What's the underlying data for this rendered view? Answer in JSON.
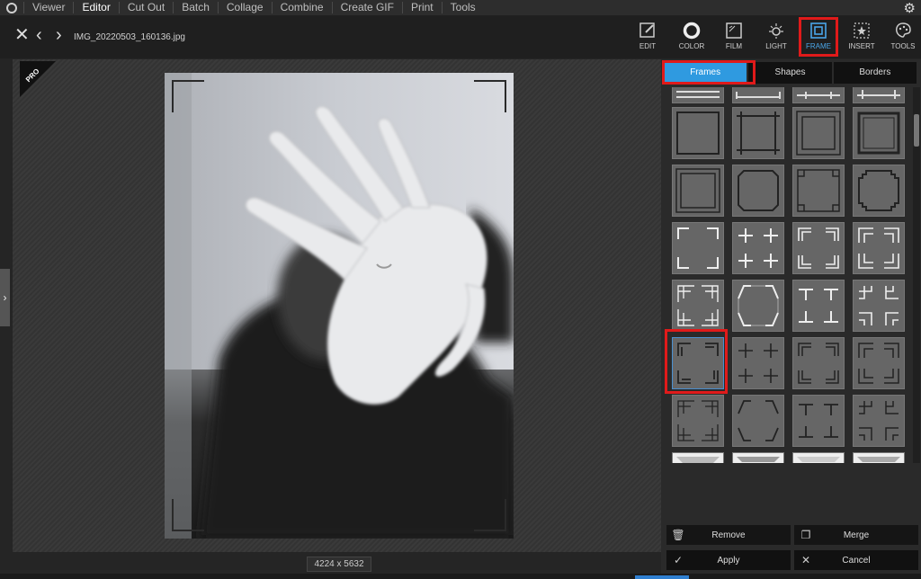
{
  "menu": {
    "items": [
      "Viewer",
      "Editor",
      "Cut Out",
      "Batch",
      "Collage",
      "Combine",
      "Create GIF",
      "Print",
      "Tools"
    ],
    "active": "Editor"
  },
  "toolbar": {
    "filename": "IMG_20220503_160136.jpg",
    "tools": [
      {
        "id": "edit",
        "label": "EDIT",
        "icon": "edit-icon"
      },
      {
        "id": "color",
        "label": "COLOR",
        "icon": "color-circle-icon"
      },
      {
        "id": "film",
        "label": "FILM",
        "icon": "film-icon"
      },
      {
        "id": "light",
        "label": "LIGHT",
        "icon": "sun-icon"
      },
      {
        "id": "frame",
        "label": "FRAME",
        "icon": "frame-icon"
      },
      {
        "id": "insert",
        "label": "INSERT",
        "icon": "insert-star-icon"
      },
      {
        "id": "tools",
        "label": "TOOLS",
        "icon": "palette-icon"
      }
    ],
    "active_tool": "frame"
  },
  "canvas": {
    "dimensions": "4224 x 5632",
    "badge": "PRO"
  },
  "panel": {
    "tabs": [
      "Frames",
      "Shapes",
      "Borders"
    ],
    "active_tab": "Frames",
    "selected_frame_index": 16,
    "actions": {
      "remove": "Remove",
      "merge": "Merge",
      "apply": "Apply",
      "cancel": "Cancel"
    }
  },
  "colors": {
    "accent": "#2f9ae0",
    "highlight": "#e01a1a"
  }
}
